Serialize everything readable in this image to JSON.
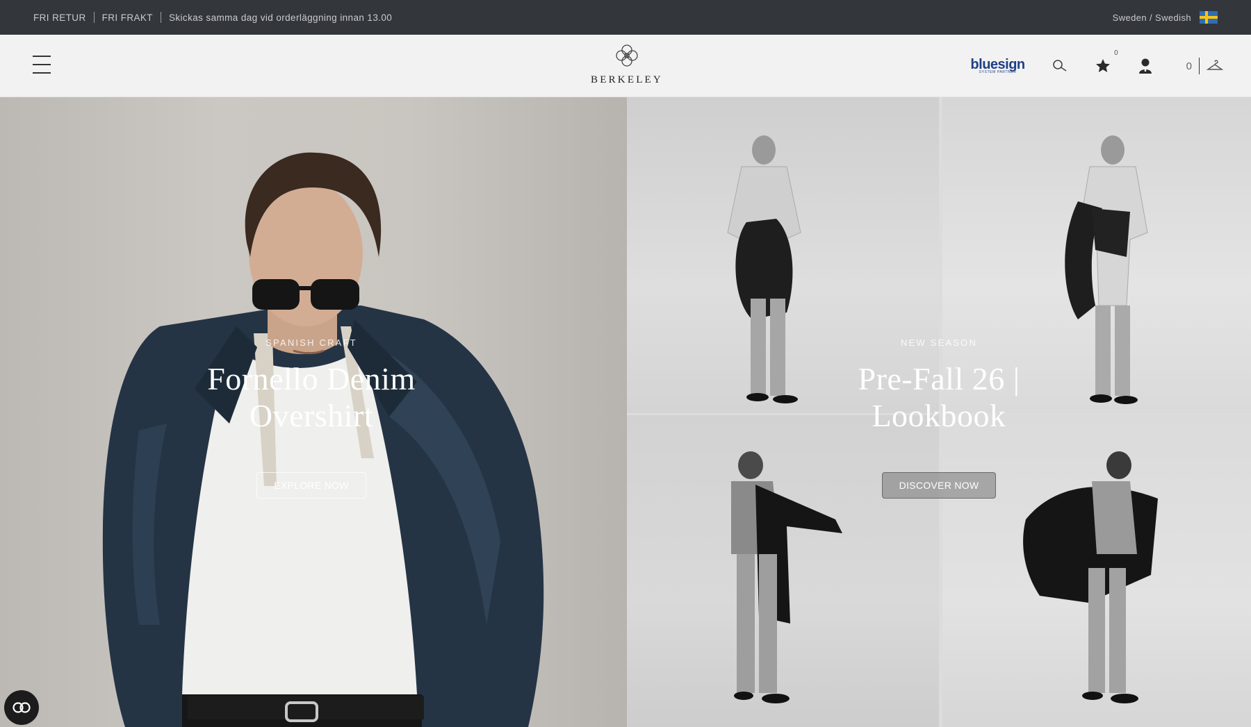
{
  "topbar": {
    "items": [
      "FRI RETUR",
      "FRI FRAKT",
      "Skickas samma dag vid orderläggning innan 13.00"
    ],
    "locale": "Sweden / Swedish"
  },
  "header": {
    "logo_text": "BERKELEY",
    "partner_name": "bluesign",
    "partner_sub": "SYSTEM PARTNER",
    "wishlist_count": "0",
    "cart_count": "0"
  },
  "hero": {
    "left": {
      "eyebrow": "SPANISH CRAFT",
      "title_line1": "Fornello Denim",
      "title_line2": "Overshirt",
      "cta": "EXPLORE NOW"
    },
    "right": {
      "eyebrow": "NEW SEASON",
      "title_line1": "Pre-Fall 26 |",
      "title_line2": "Lookbook",
      "cta": "DISCOVER NOW"
    }
  },
  "colors": {
    "topbar_bg": "#33363b",
    "header_bg": "#f2f2f2",
    "partner_blue": "#1f3f86"
  }
}
